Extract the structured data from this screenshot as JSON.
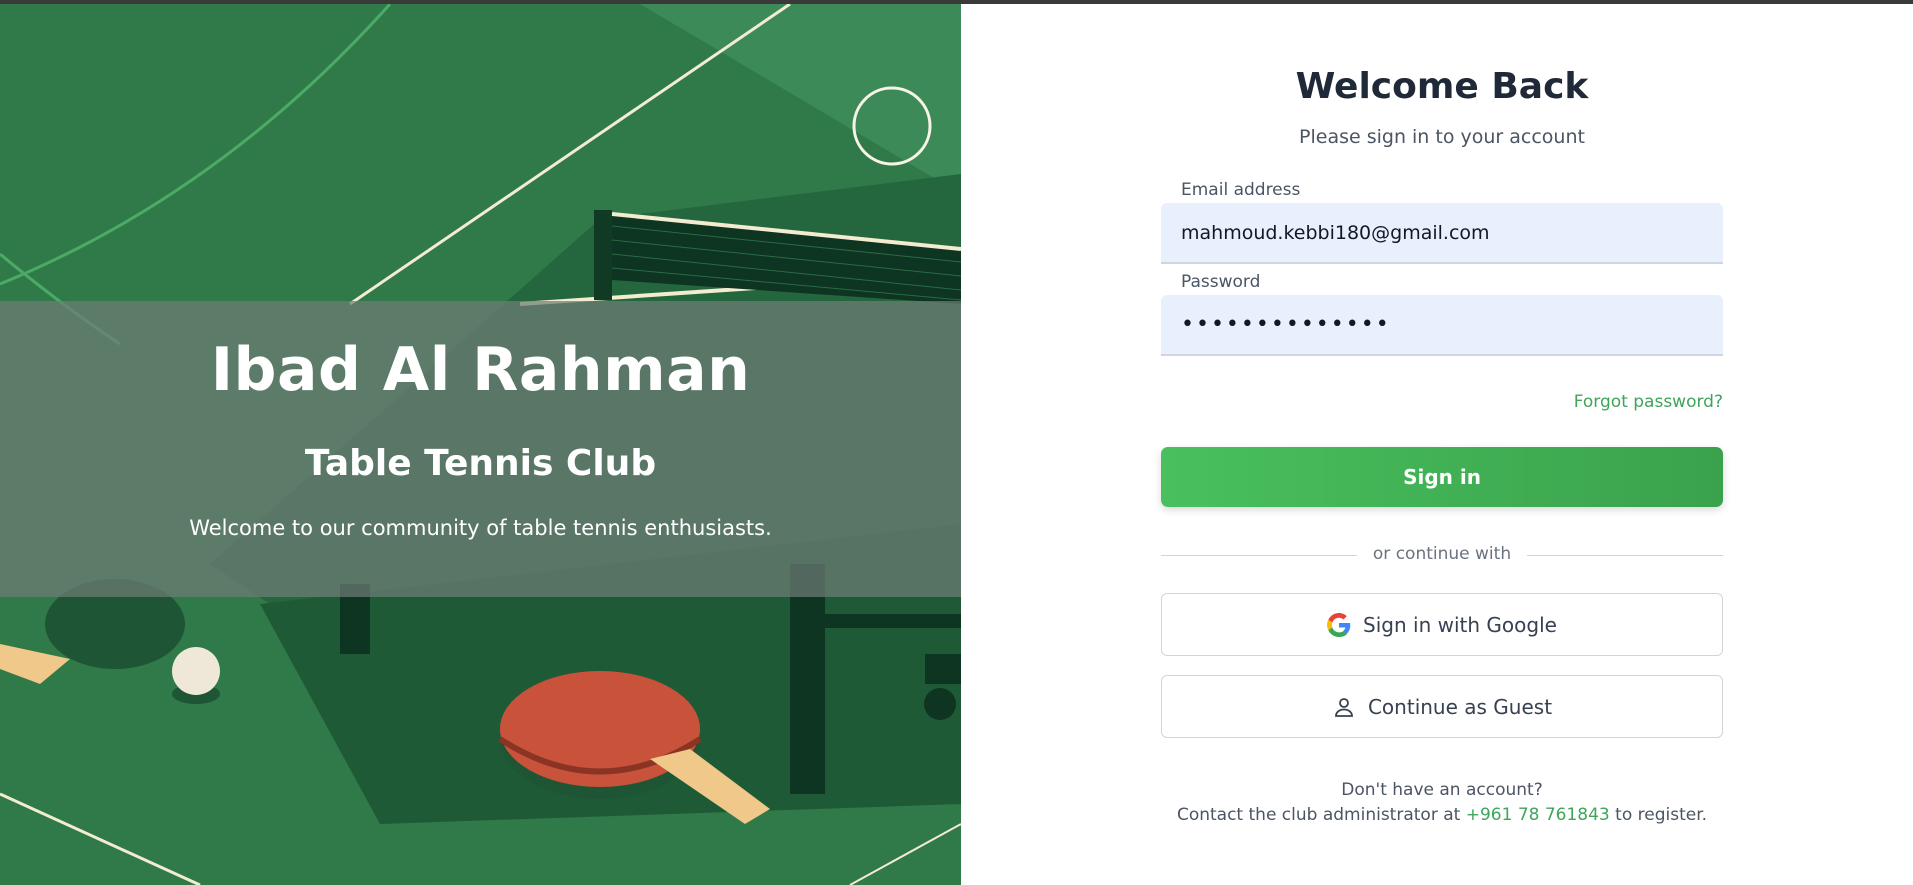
{
  "hero": {
    "title": "Ibad Al Rahman",
    "subtitle": "Table Tennis Club",
    "text": "Welcome to our community of table tennis enthusiasts."
  },
  "form": {
    "title": "Welcome Back",
    "subtitle": "Please sign in to your account",
    "email_label": "Email address",
    "email_value": "mahmoud.kebbi180@gmail.com",
    "password_label": "Password",
    "password_value": "••••••••••••••",
    "forgot_link": "Forgot password?",
    "signin_button": "Sign in",
    "divider_text": "or continue with",
    "google_button": "Sign in with Google",
    "guest_button": "Continue as Guest",
    "footer_question": "Don't have an account?",
    "footer_contact_prefix": "Contact the club administrator at",
    "footer_phone": "+961 78 761843",
    "footer_contact_suffix": "to register."
  },
  "icons": {
    "google": "google-icon",
    "guest": "user-icon"
  },
  "colors": {
    "accent_green": "#3ea55a",
    "button_green": "#49c05d",
    "title_dark": "#1f2937",
    "hero_green": "#2f7a48"
  }
}
